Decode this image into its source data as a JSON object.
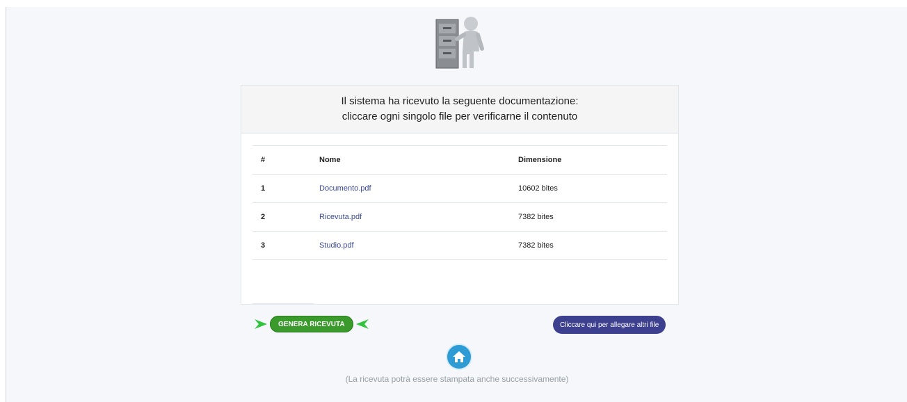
{
  "header": {
    "line1": "Il sistema ha ricevuto la seguente documentazione:",
    "line2": "cliccare ogni singolo file per verificarne il contenuto"
  },
  "table": {
    "columns": [
      "#",
      "Nome",
      "Dimensione"
    ],
    "rows": [
      {
        "num": "1",
        "name": "Documento.pdf",
        "size": "10602 bites"
      },
      {
        "num": "2",
        "name": "Ricevuta.pdf",
        "size": "7382 bites"
      },
      {
        "num": "3",
        "name": "Studio.pdf",
        "size": "7382 bites"
      }
    ]
  },
  "actions": {
    "generate_label": "GENERA RICEVUTA",
    "attach_label": "Cliccare qui per allegare altri file"
  },
  "footer": {
    "note": "(La ricevuta potrà essere stampata anche successivamente)"
  },
  "icons": {
    "hero": "filing-cabinet-figure-icon",
    "home": "home-icon",
    "arrows": "green-arrow-icon"
  },
  "colors": {
    "generate_button": "#3a9a2c",
    "attach_button": "#3d3f8f",
    "home_button": "#2e9bd4",
    "link": "#3b4a9a"
  }
}
